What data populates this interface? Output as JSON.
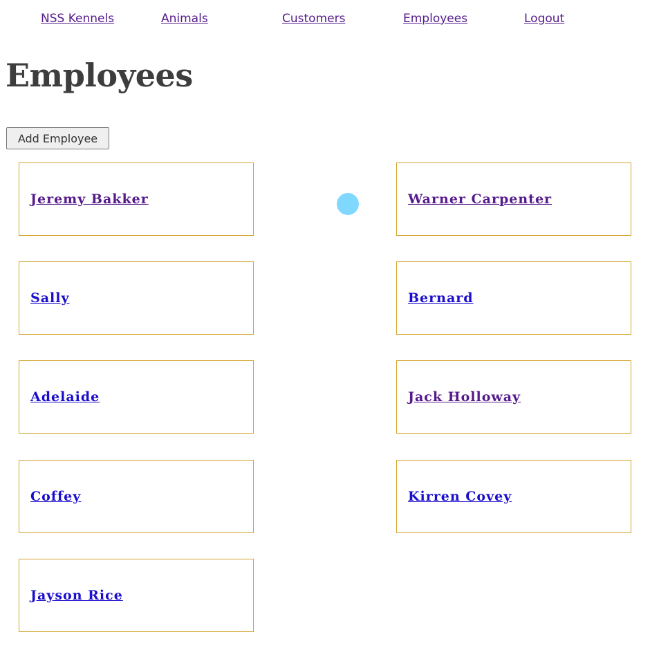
{
  "nav": {
    "items": [
      {
        "label": "NSS Kennels"
      },
      {
        "label": "Animals"
      },
      {
        "label": "Customers"
      },
      {
        "label": "Employees"
      },
      {
        "label": "Logout"
      }
    ]
  },
  "page": {
    "title": "Employees",
    "add_button_label": "Add Employee"
  },
  "employees": [
    {
      "name": "Jeremy Bakker",
      "visited": true
    },
    {
      "name": "Warner Carpenter",
      "visited": true
    },
    {
      "name": "Sally",
      "visited": false
    },
    {
      "name": "Bernard",
      "visited": false
    },
    {
      "name": "Adelaide",
      "visited": false
    },
    {
      "name": "Jack Holloway",
      "visited": true
    },
    {
      "name": "Coffey",
      "visited": false
    },
    {
      "name": "Kirren Covey",
      "visited": false
    },
    {
      "name": "Jayson Rice",
      "visited": false
    }
  ],
  "colors": {
    "visited_link": "#551a8b",
    "unvisited_link": "#1a0dcc",
    "card_border": "#d4a32c",
    "title_text": "#3d3d3d",
    "cursor_indicator": "#80d8ff"
  }
}
